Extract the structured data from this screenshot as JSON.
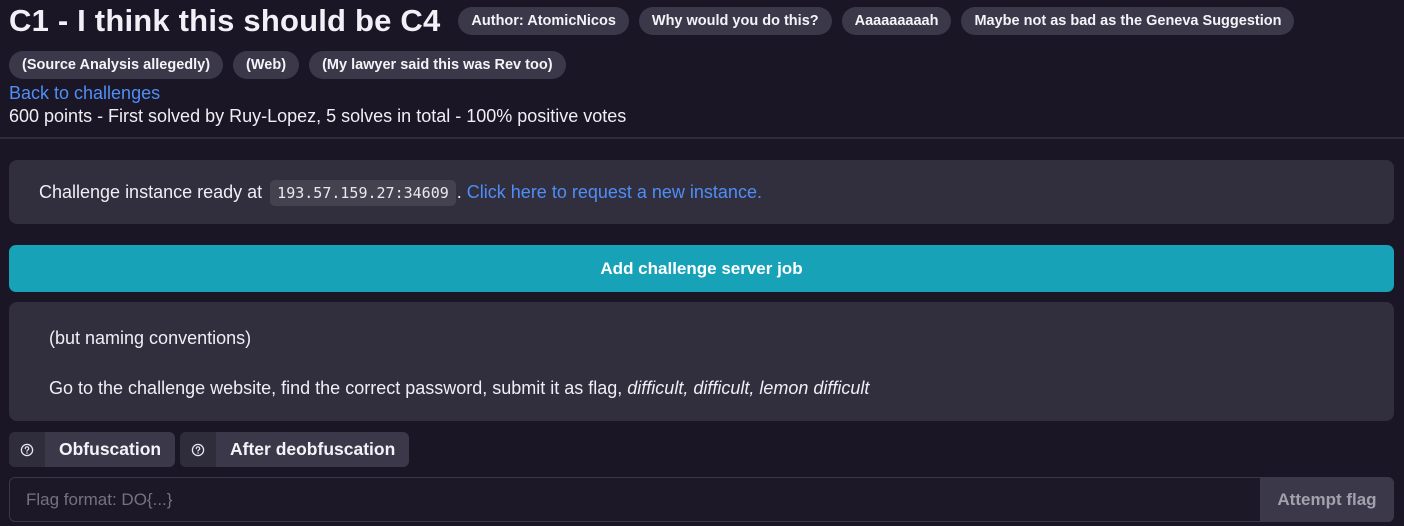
{
  "header": {
    "title": "C1 - I think this should be C4",
    "tags_row1": [
      "Author: AtomicNicos",
      "Why would you do this?",
      "Aaaaaaaaah",
      "Maybe not as bad as the Geneva Suggestion"
    ],
    "tags_row2": [
      "(Source Analysis allegedly)",
      "(Web)",
      "(My lawyer said this was Rev too)"
    ],
    "back_link": "Back to challenges",
    "stats": "600 points - First solved by Ruy-Lopez, 5 solves in total - 100% positive votes"
  },
  "instance": {
    "prefix": "Challenge instance ready at",
    "address": "193.57.159.27:34609",
    "separator": ".",
    "request_link": "Click here to request a new instance."
  },
  "add_job_button": "Add challenge server job",
  "description": {
    "line1": "(but naming conventions)",
    "line2_plain": "Go to the challenge website, find the correct password, submit it as flag, ",
    "line2_italic": "difficult, difficult, lemon difficult"
  },
  "hints": [
    {
      "icon": "question-circle-icon",
      "label": "Obfuscation"
    },
    {
      "icon": "question-circle-icon",
      "label": "After deobfuscation"
    }
  ],
  "flag": {
    "placeholder": "Flag format: DO{...}",
    "value": "",
    "submit_label": "Attempt flag"
  },
  "colors": {
    "background": "#1a1625",
    "panel": "#312e3e",
    "tag": "#3b3849",
    "link": "#4f8ef7",
    "accent_button": "#17a2b8"
  }
}
